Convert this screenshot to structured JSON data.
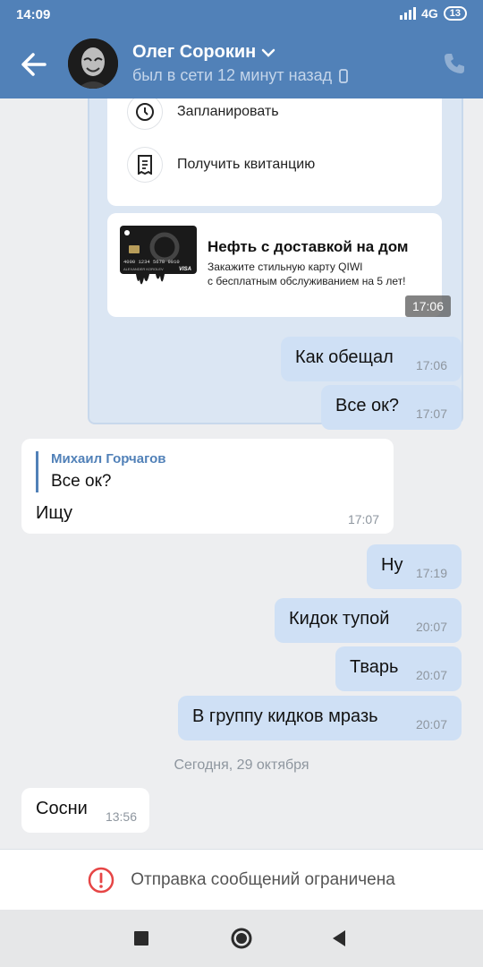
{
  "status_bar": {
    "time": "14:09",
    "network": "4G",
    "battery": "13"
  },
  "header": {
    "contact_name": "Олег Сорокин",
    "contact_status": "был в сети 12 минут назад",
    "icons": [
      "back-arrow-icon",
      "chevron-down-icon",
      "mobile-icon",
      "phone-icon"
    ]
  },
  "payment_card": {
    "actions": [
      {
        "label": "Запланировать",
        "icon": "clock-icon"
      },
      {
        "label": "Получить квитанцию",
        "icon": "receipt-icon"
      }
    ],
    "ad": {
      "title": "Нефть с доставкой на дом",
      "line1": "Закажите стильную карту QIWI",
      "line2": "с бесплатным обслуживанием на 5 лет!",
      "card_number": "4000 1234 5678 9010",
      "card_holder": "ALEXANDER KOROLEV",
      "card_brand": "VISA"
    },
    "time": "17:06"
  },
  "messages": [
    {
      "text": "Как обещал",
      "time": "17:06",
      "direction": "out"
    },
    {
      "text": "Все ок?",
      "time": "17:07",
      "direction": "out"
    },
    {
      "reply_author": "Михаил Горчагов",
      "reply_text": "Все ок?",
      "text": "Ищу",
      "time": "17:07",
      "direction": "in"
    },
    {
      "text": "Ну",
      "time": "17:19",
      "direction": "out"
    },
    {
      "text": "Кидок тупой",
      "time": "20:07",
      "direction": "out"
    },
    {
      "text": "Тварь",
      "time": "20:07",
      "direction": "out"
    },
    {
      "text": "В группу кидков мразь",
      "time": "20:07",
      "direction": "out"
    },
    {
      "text": "Сосни",
      "time": "13:56",
      "direction": "in"
    }
  ],
  "date_separator": "Сегодня, 29 октября",
  "restriction": {
    "text": "Отправка сообщений ограничена",
    "icon": "warning-icon"
  },
  "colors": {
    "header": "#5181b8",
    "outgoing": "#cfe0f5",
    "incoming": "#ffffff",
    "background": "#edeef0",
    "warning": "#e64646"
  },
  "navbar": [
    "recent-apps-icon",
    "home-icon",
    "back-triangle-icon"
  ]
}
